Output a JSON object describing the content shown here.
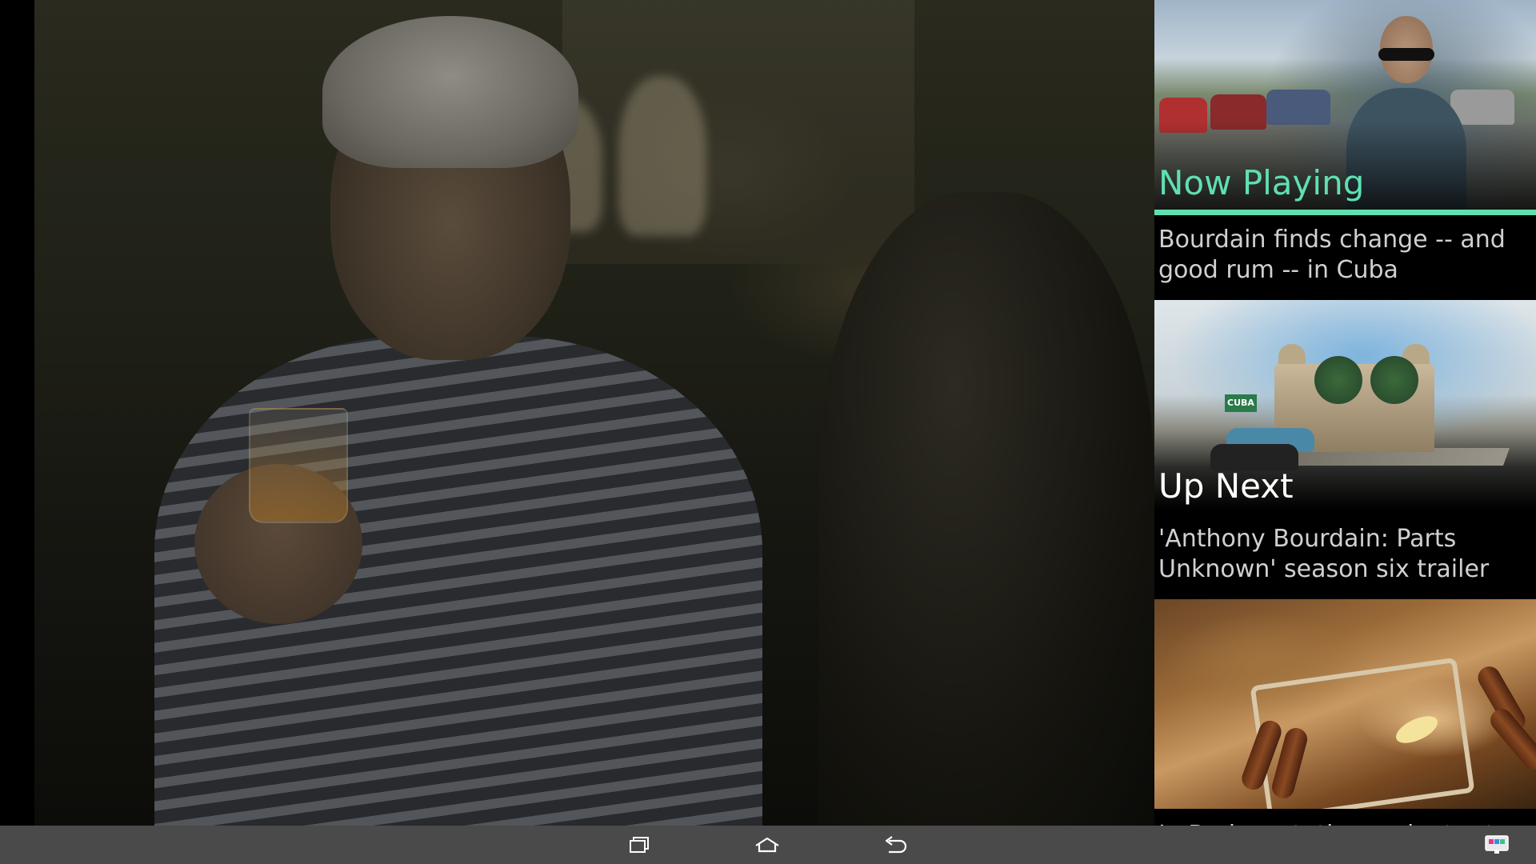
{
  "playlist": {
    "now_playing": {
      "label": "Now Playing",
      "title": "Bourdain finds change -- and good rum -- in Cuba",
      "progress": 1.0
    },
    "up_next": {
      "label": "Up Next",
      "title": "'Anthony Bourdain: Parts Unknown' season six trailer",
      "thumb_sign": "CUBA"
    },
    "third": {
      "title": "In Budapest, the ancient art of"
    }
  },
  "navbar": {
    "buttons": [
      {
        "icon": "recent-apps-icon"
      },
      {
        "icon": "home-icon"
      },
      {
        "icon": "back-icon"
      },
      {
        "icon": "cast-screen-icon"
      }
    ]
  },
  "colors": {
    "accent": "#5fe0b0",
    "navbar": "#4a4a4a",
    "caption": "#d0d0d0"
  }
}
